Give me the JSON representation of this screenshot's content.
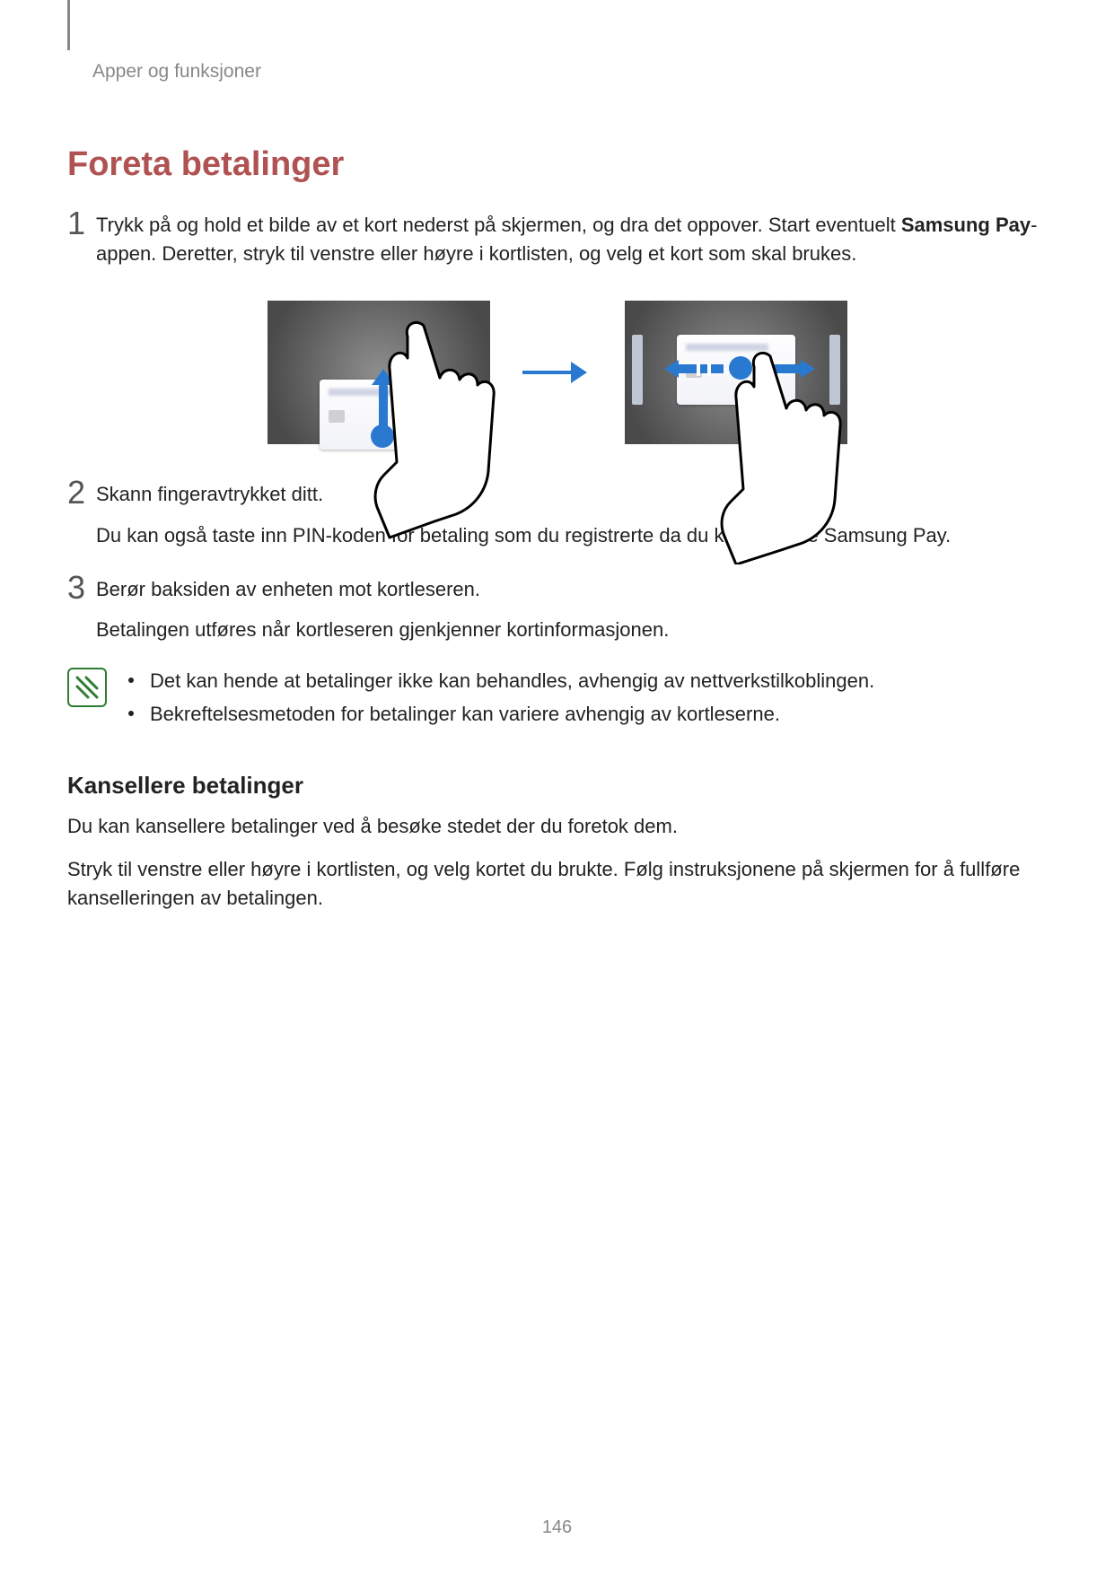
{
  "running_head": "Apper og funksjoner",
  "title": "Foreta betalinger",
  "steps": {
    "s1": {
      "num": "1",
      "text_pre": "Trykk på og hold et bilde av et kort nederst på skjermen, og dra det oppover. Start eventuelt ",
      "text_bold": "Samsung Pay",
      "text_post": "-appen. Deretter, stryk til venstre eller høyre i kortlisten, og velg et kort som skal brukes."
    },
    "s2": {
      "num": "2",
      "text": "Skann fingeravtrykket ditt.",
      "sub": "Du kan også taste inn PIN-koden for betaling som du registrerte da du konfigurerte Samsung Pay."
    },
    "s3": {
      "num": "3",
      "text": "Berør baksiden av enheten mot kortleseren.",
      "sub": "Betalingen utføres når kortleseren gjenkjenner kortinformasjonen."
    }
  },
  "notes": [
    "Det kan hende at betalinger ikke kan behandles, avhengig av nettverkstilkoblingen.",
    "Bekreftelsesmetoden for betalinger kan variere avhengig av kortleserne."
  ],
  "cancel": {
    "heading": "Kansellere betalinger",
    "p1": "Du kan kansellere betalinger ved å besøke stedet der du foretok dem.",
    "p2": "Stryk til venstre eller høyre i kortlisten, og velg kortet du brukte. Følg instruksjonene på skjermen for å fullføre kanselleringen av betalingen."
  },
  "page_number": "146"
}
